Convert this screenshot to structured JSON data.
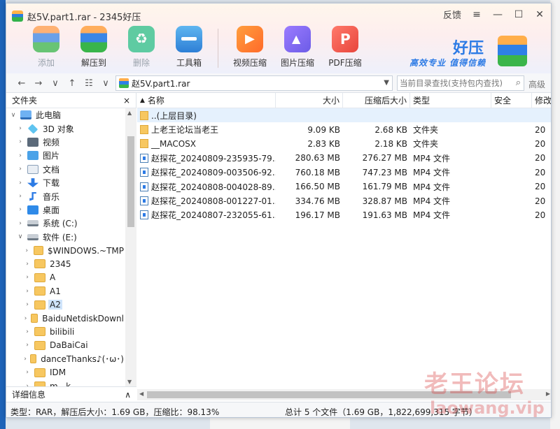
{
  "window": {
    "title": "赵5V.part1.rar - 2345好压",
    "feedback": "反馈"
  },
  "toolbar": {
    "buttons": [
      {
        "label": "添加",
        "icon": "add-archive-icon",
        "enabled": false
      },
      {
        "label": "解压到",
        "icon": "extract-icon",
        "enabled": true
      },
      {
        "label": "删除",
        "icon": "delete-icon",
        "enabled": false
      },
      {
        "label": "工具箱",
        "icon": "toolbox-icon",
        "enabled": true
      },
      {
        "label": "视频压缩",
        "icon": "video-compress-icon",
        "enabled": true
      },
      {
        "label": "图片压缩",
        "icon": "image-compress-icon",
        "enabled": true
      },
      {
        "label": "PDF压缩",
        "icon": "pdf-compress-icon",
        "enabled": true
      }
    ]
  },
  "brand": {
    "name": "好压",
    "slogan": "高效专业  值得信赖"
  },
  "address": {
    "path": "赵5V.part1.rar",
    "search_placeholder": "当前目录查找(支持包内查找)",
    "advanced": "高级"
  },
  "left_panel": {
    "title": "文件夹",
    "close": "×",
    "details_title": "详细信息",
    "tree": [
      {
        "label": "此电脑",
        "icon": "pc",
        "level": 0,
        "expanded": true
      },
      {
        "label": "3D 对象",
        "icon": "obj",
        "level": 1
      },
      {
        "label": "视频",
        "icon": "video",
        "level": 1
      },
      {
        "label": "图片",
        "icon": "pic",
        "level": 1
      },
      {
        "label": "文档",
        "icon": "doc",
        "level": 1
      },
      {
        "label": "下载",
        "icon": "dl",
        "level": 1
      },
      {
        "label": "音乐",
        "icon": "music",
        "level": 1
      },
      {
        "label": "桌面",
        "icon": "desk",
        "level": 1
      },
      {
        "label": "系统 (C:)",
        "icon": "drive",
        "level": 1
      },
      {
        "label": "软件 (E:)",
        "icon": "drive",
        "level": 1,
        "expanded": true
      },
      {
        "label": "$WINDOWS.~TMP",
        "icon": "folder",
        "level": 2
      },
      {
        "label": "2345",
        "icon": "folder",
        "level": 2
      },
      {
        "label": "A",
        "icon": "folder",
        "level": 2
      },
      {
        "label": "A1",
        "icon": "folder",
        "level": 2
      },
      {
        "label": "A2",
        "icon": "folder",
        "level": 2,
        "selected": true
      },
      {
        "label": "BaiduNetdiskDownl",
        "icon": "folder",
        "level": 2
      },
      {
        "label": "bilibili",
        "icon": "folder",
        "level": 2
      },
      {
        "label": "DaBaiCai",
        "icon": "folder",
        "level": 2
      },
      {
        "label": "danceThanks♪(･ω･)",
        "icon": "folder",
        "level": 2
      },
      {
        "label": "IDM",
        "icon": "folder",
        "level": 2
      },
      {
        "label": "m...k",
        "icon": "folder",
        "level": 2
      }
    ]
  },
  "file_list": {
    "columns": [
      "名称",
      "大小",
      "压缩后大小",
      "类型",
      "安全",
      "修改"
    ],
    "rows": [
      {
        "name": "..(上层目录)",
        "size": "",
        "csize": "",
        "type": "",
        "mod": "",
        "icon": "folder"
      },
      {
        "name": "上老王论坛当老王",
        "size": "9.09 KB",
        "csize": "2.68 KB",
        "type": "文件夹",
        "mod": "20",
        "icon": "folder"
      },
      {
        "name": "__MACOSX",
        "size": "2.83 KB",
        "csize": "2.18 KB",
        "type": "文件夹",
        "mod": "20",
        "icon": "folder"
      },
      {
        "name": "赵探花_20240809-235935-79...",
        "size": "280.63 MB",
        "csize": "276.27 MB",
        "type": "MP4 文件",
        "mod": "20",
        "icon": "mp4"
      },
      {
        "name": "赵探花_20240809-003506-92...",
        "size": "760.18 MB",
        "csize": "747.23 MB",
        "type": "MP4 文件",
        "mod": "20",
        "icon": "mp4"
      },
      {
        "name": "赵探花_20240808-004028-89...",
        "size": "166.50 MB",
        "csize": "161.79 MB",
        "type": "MP4 文件",
        "mod": "20",
        "icon": "mp4"
      },
      {
        "name": "赵探花_20240808-001227-01...",
        "size": "334.76 MB",
        "csize": "328.87 MB",
        "type": "MP4 文件",
        "mod": "20",
        "icon": "mp4"
      },
      {
        "name": "赵探花_20240807-232055-61...",
        "size": "196.17 MB",
        "csize": "191.63 MB",
        "type": "MP4 文件",
        "mod": "20",
        "icon": "mp4"
      }
    ]
  },
  "status": {
    "left": "类型：RAR，解压后大小：1.69 GB，压缩比：98.13%",
    "right": "总计 5 个文件（1.69 GB，1,822,699,315 字节）"
  },
  "watermark": {
    "line1": "老王论坛",
    "line2": "laowang.vip"
  }
}
